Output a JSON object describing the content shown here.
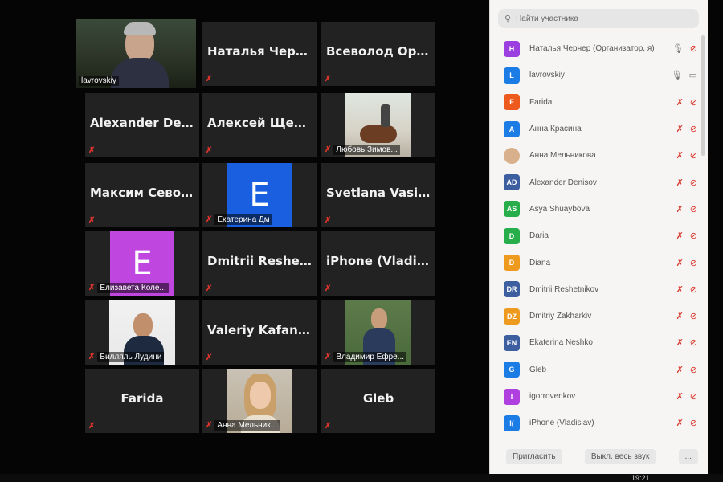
{
  "grid": {
    "tiles": [
      {
        "name": "lavrovskiy",
        "type": "video",
        "footer": "lavrovskiy",
        "mic_off": false,
        "active": true
      },
      {
        "name": "Наталья Чернер",
        "type": "name",
        "footer": "",
        "mic_off": true
      },
      {
        "name": "Всеволод Орлов",
        "type": "name",
        "footer": "",
        "mic_off": true
      },
      {
        "name": "Alexander Deni...",
        "type": "name",
        "footer": "",
        "mic_off": true
      },
      {
        "name": "Алексей Щеглов",
        "type": "name",
        "footer": "",
        "mic_off": true
      },
      {
        "name": "",
        "type": "video",
        "footer": "Любовь Зимов...",
        "mic_off": true
      },
      {
        "name": "Максим Севост...",
        "type": "name",
        "footer": "",
        "mic_off": true
      },
      {
        "name": "E",
        "type": "letter",
        "color": "#1a5fe0",
        "footer": "Екатерина Дм",
        "mic_off": true
      },
      {
        "name": "Svetlana Vasilieva",
        "type": "name",
        "footer": "",
        "mic_off": true
      },
      {
        "name": "E",
        "type": "letter",
        "color": "#c046e0",
        "footer": "Елизавета Коле...",
        "mic_off": true
      },
      {
        "name": "Dmitrii Reshetni...",
        "type": "name",
        "footer": "",
        "mic_off": true
      },
      {
        "name": "iPhone (Vladislav)",
        "type": "name",
        "footer": "",
        "mic_off": true
      },
      {
        "name": "",
        "type": "video",
        "footer": "Билляль Лудини",
        "mic_off": true
      },
      {
        "name": "Valeriy Kafanov",
        "type": "name",
        "footer": "",
        "mic_off": true
      },
      {
        "name": "",
        "type": "video",
        "footer": "Владимир Ефре...",
        "mic_off": true
      },
      {
        "name": "Farida",
        "type": "name",
        "footer": "",
        "mic_off": true
      },
      {
        "name": "",
        "type": "video",
        "footer": "Анна Мельник...",
        "mic_off": true
      },
      {
        "name": "Gleb",
        "type": "name",
        "footer": "",
        "mic_off": true
      }
    ]
  },
  "panel": {
    "search_placeholder": "Найти участника",
    "participants": [
      {
        "initials": "Н",
        "name": "Наталья Чернер (Организатор, я)",
        "color": "#9b3fe0",
        "mic_on": true,
        "cam_on": false
      },
      {
        "initials": "L",
        "name": "lavrovskiy",
        "color": "#1c7ce6",
        "mic_on": true,
        "cam_on": true
      },
      {
        "initials": "F",
        "name": "Farida",
        "color": "#ee5a1e",
        "mic_on": false,
        "cam_on": false
      },
      {
        "initials": "А",
        "name": "Анна Красина",
        "color": "#1c7ce6",
        "mic_on": false,
        "cam_on": false
      },
      {
        "initials": "",
        "name": "Анна Мельникова",
        "color": "#d9b08c",
        "mic_on": false,
        "cam_on": false
      },
      {
        "initials": "AD",
        "name": "Alexander Denisov",
        "color": "#3d5fa0",
        "mic_on": false,
        "cam_on": false
      },
      {
        "initials": "AS",
        "name": "Asya Shuaybova",
        "color": "#27ad4a",
        "mic_on": false,
        "cam_on": false
      },
      {
        "initials": "D",
        "name": "Daria",
        "color": "#27ad4a",
        "mic_on": false,
        "cam_on": false
      },
      {
        "initials": "D",
        "name": "Diana",
        "color": "#ee9a1e",
        "mic_on": false,
        "cam_on": false
      },
      {
        "initials": "DR",
        "name": "Dmitrii Reshetnikov",
        "color": "#3d5fa0",
        "mic_on": false,
        "cam_on": false
      },
      {
        "initials": "DZ",
        "name": "Dmitriy Zakharkiv",
        "color": "#ee9a1e",
        "mic_on": false,
        "cam_on": false
      },
      {
        "initials": "EN",
        "name": "Ekaterina Neshko",
        "color": "#3d5fa0",
        "mic_on": false,
        "cam_on": false
      },
      {
        "initials": "G",
        "name": "Gleb",
        "color": "#1c7ce6",
        "mic_on": false,
        "cam_on": false
      },
      {
        "initials": "I",
        "name": "igorrovenkov",
        "color": "#b03fe0",
        "mic_on": false,
        "cam_on": false
      },
      {
        "initials": "I(",
        "name": "iPhone (Vladislav)",
        "color": "#1c7ce6",
        "mic_on": false,
        "cam_on": false
      }
    ],
    "invite_label": "Пригласить",
    "mute_all_label": "Выкл. весь звук",
    "more_label": "..."
  },
  "taskbar": {
    "clock": "19:21"
  }
}
